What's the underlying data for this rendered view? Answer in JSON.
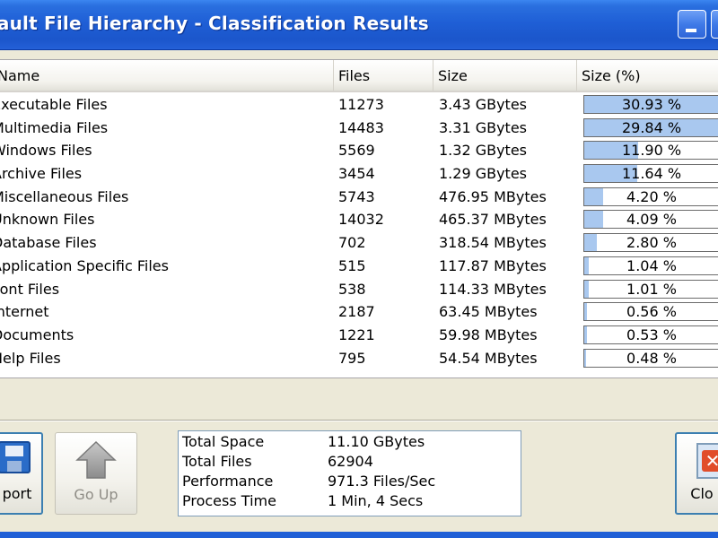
{
  "window": {
    "title": "fault File Hierarchy - Classification Results"
  },
  "columns": {
    "name": "Name",
    "files": "Files",
    "size": "Size",
    "size_pct": "Size (%)"
  },
  "rows": [
    {
      "name": "Executable Files",
      "files": "11273",
      "size": "3.43 GBytes",
      "pct_label": "30.93 %",
      "pct": 30.93
    },
    {
      "name": "Multimedia Files",
      "files": "14483",
      "size": "3.31 GBytes",
      "pct_label": "29.84 %",
      "pct": 29.84
    },
    {
      "name": "Windows Files",
      "files": "5569",
      "size": "1.32 GBytes",
      "pct_label": "11.90 %",
      "pct": 11.9
    },
    {
      "name": "Archive Files",
      "files": "3454",
      "size": "1.29 GBytes",
      "pct_label": "11.64 %",
      "pct": 11.64
    },
    {
      "name": "Miscellaneous Files",
      "files": "5743",
      "size": "476.95 MBytes",
      "pct_label": "4.20 %",
      "pct": 4.2
    },
    {
      "name": "Unknown Files",
      "files": "14032",
      "size": "465.37 MBytes",
      "pct_label": "4.09 %",
      "pct": 4.09
    },
    {
      "name": "Database Files",
      "files": "702",
      "size": "318.54 MBytes",
      "pct_label": "2.80 %",
      "pct": 2.8
    },
    {
      "name": "Application Specific Files",
      "files": "515",
      "size": "117.87 MBytes",
      "pct_label": "1.04 %",
      "pct": 1.04
    },
    {
      "name": "Font Files",
      "files": "538",
      "size": "114.33 MBytes",
      "pct_label": "1.01 %",
      "pct": 1.01
    },
    {
      "name": "Internet",
      "files": "2187",
      "size": "63.45 MBytes",
      "pct_label": "0.56 %",
      "pct": 0.56
    },
    {
      "name": "Documents",
      "files": "1221",
      "size": "59.98 MBytes",
      "pct_label": "0.53 %",
      "pct": 0.53
    },
    {
      "name": "Help Files",
      "files": "795",
      "size": "54.54 MBytes",
      "pct_label": "0.48 %",
      "pct": 0.48
    }
  ],
  "buttons": {
    "export": "port",
    "go_up": "Go Up",
    "close": "Clo"
  },
  "stats": [
    {
      "label": "Total Space",
      "value": "11.10 GBytes"
    },
    {
      "label": "Total Files",
      "value": "62904"
    },
    {
      "label": "Performance",
      "value": "971.3 Files/Sec"
    },
    {
      "label": "Process Time",
      "value": "1 Min, 4 Secs"
    }
  ],
  "colors": {
    "titlebar": "#1f5fd6",
    "progress_fill": "#a9c8ef",
    "window_bg": "#ece9d8"
  },
  "icons": {
    "export": "floppy-disk-icon",
    "go_up": "up-arrow-icon",
    "close": "close-icon"
  }
}
